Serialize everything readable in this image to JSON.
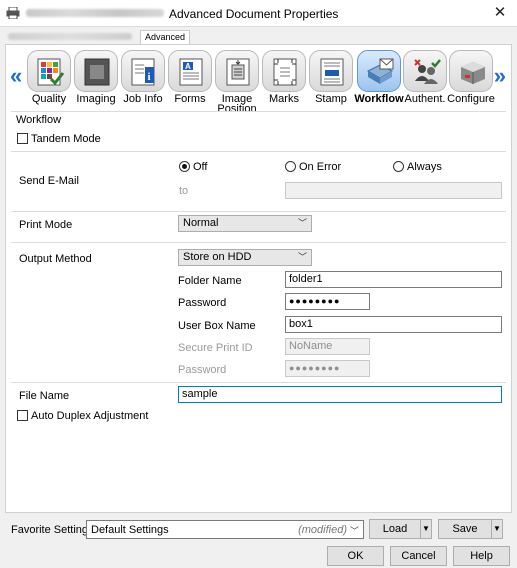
{
  "window": {
    "title": "Advanced Document Properties",
    "close_glyph": "✕",
    "app_icon": "printer-icon"
  },
  "tabs": {
    "advanced": "Advanced"
  },
  "toolbar": {
    "left_arrow": "«",
    "right_arrow": "»",
    "items": [
      {
        "label": "Quality",
        "icon": "quality-icon"
      },
      {
        "label": "Imaging",
        "icon": "imaging-icon"
      },
      {
        "label": "Job Info",
        "icon": "job-info-icon"
      },
      {
        "label": "Forms",
        "icon": "forms-icon"
      },
      {
        "label": "Image Position",
        "icon": "image-position-icon"
      },
      {
        "label": "Marks",
        "icon": "marks-icon"
      },
      {
        "label": "Stamp",
        "icon": "stamp-icon"
      },
      {
        "label": "Workflow",
        "icon": "workflow-icon",
        "active": true
      },
      {
        "label": "Authent.",
        "icon": "authentication-icon"
      },
      {
        "label": "Configure",
        "icon": "configure-icon"
      }
    ]
  },
  "workflow": {
    "section_title": "Workflow",
    "tandem_mode": "Tandem Mode",
    "send_email": {
      "label": "Send E-Mail",
      "options": [
        "Off",
        "On Error",
        "Always"
      ],
      "selected": "Off",
      "to_label": "to",
      "to_value": ""
    },
    "print_mode": {
      "label": "Print Mode",
      "value": "Normal"
    },
    "output_method": {
      "label": "Output Method",
      "value": "Store on HDD",
      "folder_name_label": "Folder Name",
      "folder_name_value": "folder1",
      "password_label": "Password",
      "password_value": "●●●●●●●●",
      "user_box_name_label": "User Box Name",
      "user_box_name_value": "box1",
      "secure_print_id_label": "Secure Print ID",
      "secure_print_id_value": "NoName",
      "secure_password_label": "Password",
      "secure_password_value": "●●●●●●●●"
    },
    "file_name": {
      "label": "File Name",
      "value": "sample"
    },
    "auto_duplex": "Auto Duplex Adjustment"
  },
  "footer": {
    "favorite_label": "Favorite Setting",
    "favorite_value": "Default Settings",
    "favorite_status": "(modified)",
    "load": "Load",
    "save": "Save",
    "ok": "OK",
    "cancel": "Cancel",
    "help": "Help"
  },
  "colors": {
    "accent": "#0078d7",
    "nav_arrow": "#1f6fd1",
    "active_tab": "#9cc4ef"
  }
}
